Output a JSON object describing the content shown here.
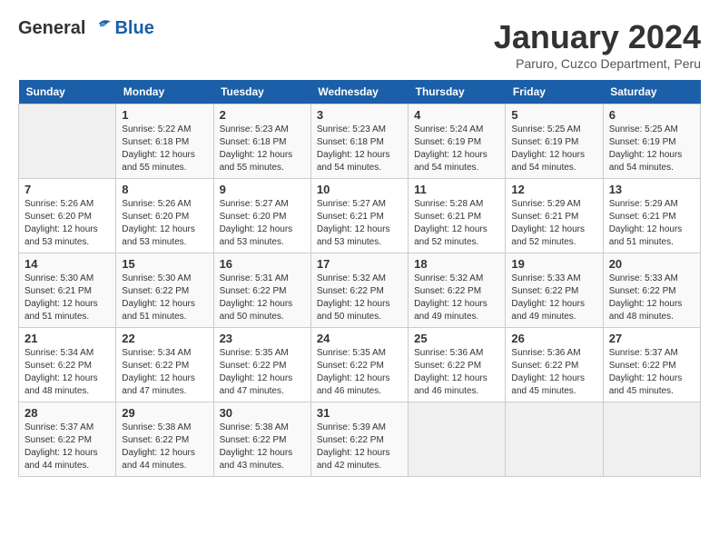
{
  "header": {
    "logo_general": "General",
    "logo_blue": "Blue",
    "title": "January 2024",
    "subtitle": "Paruro, Cuzco Department, Peru"
  },
  "days_of_week": [
    "Sunday",
    "Monday",
    "Tuesday",
    "Wednesday",
    "Thursday",
    "Friday",
    "Saturday"
  ],
  "weeks": [
    [
      {
        "day": "",
        "info": ""
      },
      {
        "day": "1",
        "info": "Sunrise: 5:22 AM\nSunset: 6:18 PM\nDaylight: 12 hours\nand 55 minutes."
      },
      {
        "day": "2",
        "info": "Sunrise: 5:23 AM\nSunset: 6:18 PM\nDaylight: 12 hours\nand 55 minutes."
      },
      {
        "day": "3",
        "info": "Sunrise: 5:23 AM\nSunset: 6:18 PM\nDaylight: 12 hours\nand 54 minutes."
      },
      {
        "day": "4",
        "info": "Sunrise: 5:24 AM\nSunset: 6:19 PM\nDaylight: 12 hours\nand 54 minutes."
      },
      {
        "day": "5",
        "info": "Sunrise: 5:25 AM\nSunset: 6:19 PM\nDaylight: 12 hours\nand 54 minutes."
      },
      {
        "day": "6",
        "info": "Sunrise: 5:25 AM\nSunset: 6:19 PM\nDaylight: 12 hours\nand 54 minutes."
      }
    ],
    [
      {
        "day": "7",
        "info": "Sunrise: 5:26 AM\nSunset: 6:20 PM\nDaylight: 12 hours\nand 53 minutes."
      },
      {
        "day": "8",
        "info": "Sunrise: 5:26 AM\nSunset: 6:20 PM\nDaylight: 12 hours\nand 53 minutes."
      },
      {
        "day": "9",
        "info": "Sunrise: 5:27 AM\nSunset: 6:20 PM\nDaylight: 12 hours\nand 53 minutes."
      },
      {
        "day": "10",
        "info": "Sunrise: 5:27 AM\nSunset: 6:21 PM\nDaylight: 12 hours\nand 53 minutes."
      },
      {
        "day": "11",
        "info": "Sunrise: 5:28 AM\nSunset: 6:21 PM\nDaylight: 12 hours\nand 52 minutes."
      },
      {
        "day": "12",
        "info": "Sunrise: 5:29 AM\nSunset: 6:21 PM\nDaylight: 12 hours\nand 52 minutes."
      },
      {
        "day": "13",
        "info": "Sunrise: 5:29 AM\nSunset: 6:21 PM\nDaylight: 12 hours\nand 51 minutes."
      }
    ],
    [
      {
        "day": "14",
        "info": "Sunrise: 5:30 AM\nSunset: 6:21 PM\nDaylight: 12 hours\nand 51 minutes."
      },
      {
        "day": "15",
        "info": "Sunrise: 5:30 AM\nSunset: 6:22 PM\nDaylight: 12 hours\nand 51 minutes."
      },
      {
        "day": "16",
        "info": "Sunrise: 5:31 AM\nSunset: 6:22 PM\nDaylight: 12 hours\nand 50 minutes."
      },
      {
        "day": "17",
        "info": "Sunrise: 5:32 AM\nSunset: 6:22 PM\nDaylight: 12 hours\nand 50 minutes."
      },
      {
        "day": "18",
        "info": "Sunrise: 5:32 AM\nSunset: 6:22 PM\nDaylight: 12 hours\nand 49 minutes."
      },
      {
        "day": "19",
        "info": "Sunrise: 5:33 AM\nSunset: 6:22 PM\nDaylight: 12 hours\nand 49 minutes."
      },
      {
        "day": "20",
        "info": "Sunrise: 5:33 AM\nSunset: 6:22 PM\nDaylight: 12 hours\nand 48 minutes."
      }
    ],
    [
      {
        "day": "21",
        "info": "Sunrise: 5:34 AM\nSunset: 6:22 PM\nDaylight: 12 hours\nand 48 minutes."
      },
      {
        "day": "22",
        "info": "Sunrise: 5:34 AM\nSunset: 6:22 PM\nDaylight: 12 hours\nand 47 minutes."
      },
      {
        "day": "23",
        "info": "Sunrise: 5:35 AM\nSunset: 6:22 PM\nDaylight: 12 hours\nand 47 minutes."
      },
      {
        "day": "24",
        "info": "Sunrise: 5:35 AM\nSunset: 6:22 PM\nDaylight: 12 hours\nand 46 minutes."
      },
      {
        "day": "25",
        "info": "Sunrise: 5:36 AM\nSunset: 6:22 PM\nDaylight: 12 hours\nand 46 minutes."
      },
      {
        "day": "26",
        "info": "Sunrise: 5:36 AM\nSunset: 6:22 PM\nDaylight: 12 hours\nand 45 minutes."
      },
      {
        "day": "27",
        "info": "Sunrise: 5:37 AM\nSunset: 6:22 PM\nDaylight: 12 hours\nand 45 minutes."
      }
    ],
    [
      {
        "day": "28",
        "info": "Sunrise: 5:37 AM\nSunset: 6:22 PM\nDaylight: 12 hours\nand 44 minutes."
      },
      {
        "day": "29",
        "info": "Sunrise: 5:38 AM\nSunset: 6:22 PM\nDaylight: 12 hours\nand 44 minutes."
      },
      {
        "day": "30",
        "info": "Sunrise: 5:38 AM\nSunset: 6:22 PM\nDaylight: 12 hours\nand 43 minutes."
      },
      {
        "day": "31",
        "info": "Sunrise: 5:39 AM\nSunset: 6:22 PM\nDaylight: 12 hours\nand 42 minutes."
      },
      {
        "day": "",
        "info": ""
      },
      {
        "day": "",
        "info": ""
      },
      {
        "day": "",
        "info": ""
      }
    ]
  ]
}
